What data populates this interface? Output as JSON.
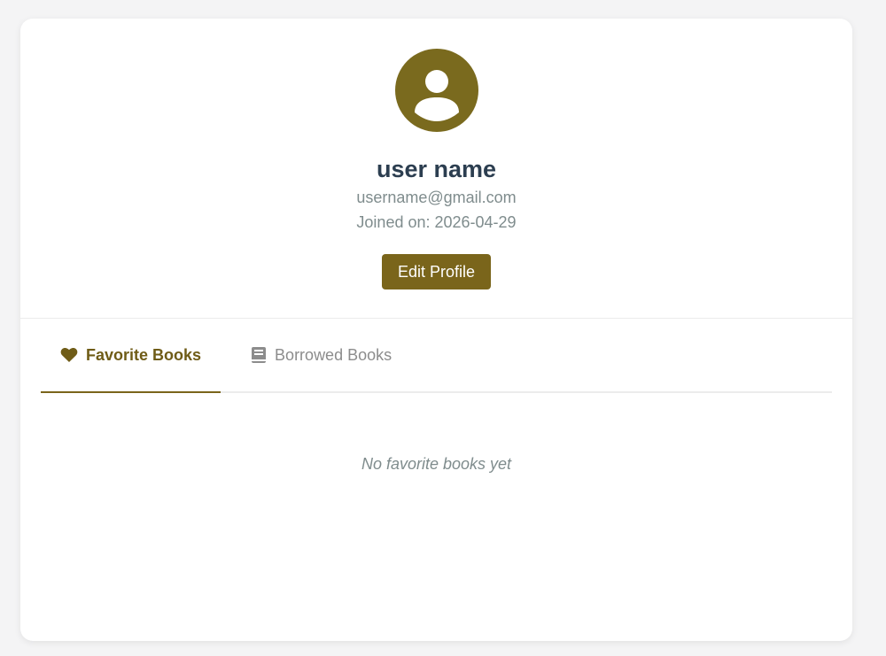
{
  "profile": {
    "name": "user name",
    "email": "username@gmail.com",
    "joined": "Joined on: 2026-04-29",
    "edit_label": "Edit Profile",
    "avatar_icon": "user-circle-icon"
  },
  "tabs": [
    {
      "label": "Favorite Books",
      "icon": "heart-icon",
      "active": true
    },
    {
      "label": "Borrowed Books",
      "icon": "book-icon",
      "active": false
    }
  ],
  "content": {
    "empty_message": "No favorite books yet"
  },
  "colors": {
    "accent": "#7a651b",
    "title": "#2c3e50",
    "muted": "#7f8c8d"
  }
}
